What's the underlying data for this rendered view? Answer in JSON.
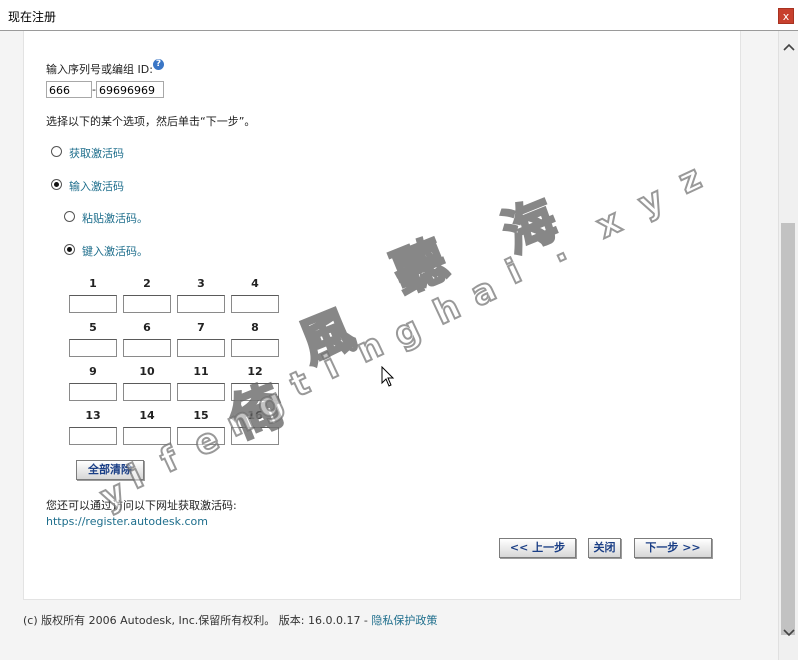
{
  "window": {
    "title": "现在注册",
    "close_label": "x"
  },
  "serial": {
    "label": "输入序列号或编组 ID:",
    "prefix_value": "666",
    "separator": "-",
    "number_value": "69696969"
  },
  "instruction": "选择以下的某个选项，然后单击“下一步”。",
  "options": {
    "get_code": {
      "label": "获取激活码",
      "selected": false
    },
    "enter_code": {
      "label": "输入激活码",
      "selected": true
    },
    "paste_code": {
      "label": "粘贴激活码。",
      "selected": false
    },
    "type_code": {
      "label": "键入激活码。",
      "selected": true
    }
  },
  "code_grid": {
    "labels": [
      "1",
      "2",
      "3",
      "4",
      "5",
      "6",
      "7",
      "8",
      "9",
      "10",
      "11",
      "12",
      "13",
      "14",
      "15",
      "16"
    ],
    "values": [
      "",
      "",
      "",
      "",
      "",
      "",
      "",
      "",
      "",
      "",
      "",
      "",
      "",
      "",
      "",
      ""
    ]
  },
  "clear_all_label": "全部清除",
  "url_note": "您还可以通过访问以下网址获取激活码:",
  "url_link": "https://register.autodesk.com",
  "nav": {
    "prev_label": "<< 上一步",
    "close_label": "关闭",
    "next_label": "下一步 >>"
  },
  "footer": {
    "copyright": "(c) 版权所有 2006 Autodesk, Inc.保留所有权利。 版本: 16.0.0.17 - ",
    "privacy_label": "隐私保护政策"
  },
  "watermark": {
    "chars": [
      "倚",
      "風",
      "聽",
      "海"
    ],
    "latin": [
      "y",
      "i",
      "f",
      "e",
      "n",
      "g",
      "t",
      "i",
      "n",
      "g",
      "h",
      "a",
      "i",
      ".",
      "x",
      "y",
      "z"
    ]
  },
  "icons": {
    "help": "help-icon",
    "scroll_up": "chevron-up-icon",
    "scroll_down": "chevron-down-icon",
    "cursor": "mouse-cursor-icon"
  },
  "colors": {
    "link": "#1e6e8c",
    "button_text": "#1b3f86",
    "close": "#c7402e",
    "help": "#3a76c6"
  }
}
